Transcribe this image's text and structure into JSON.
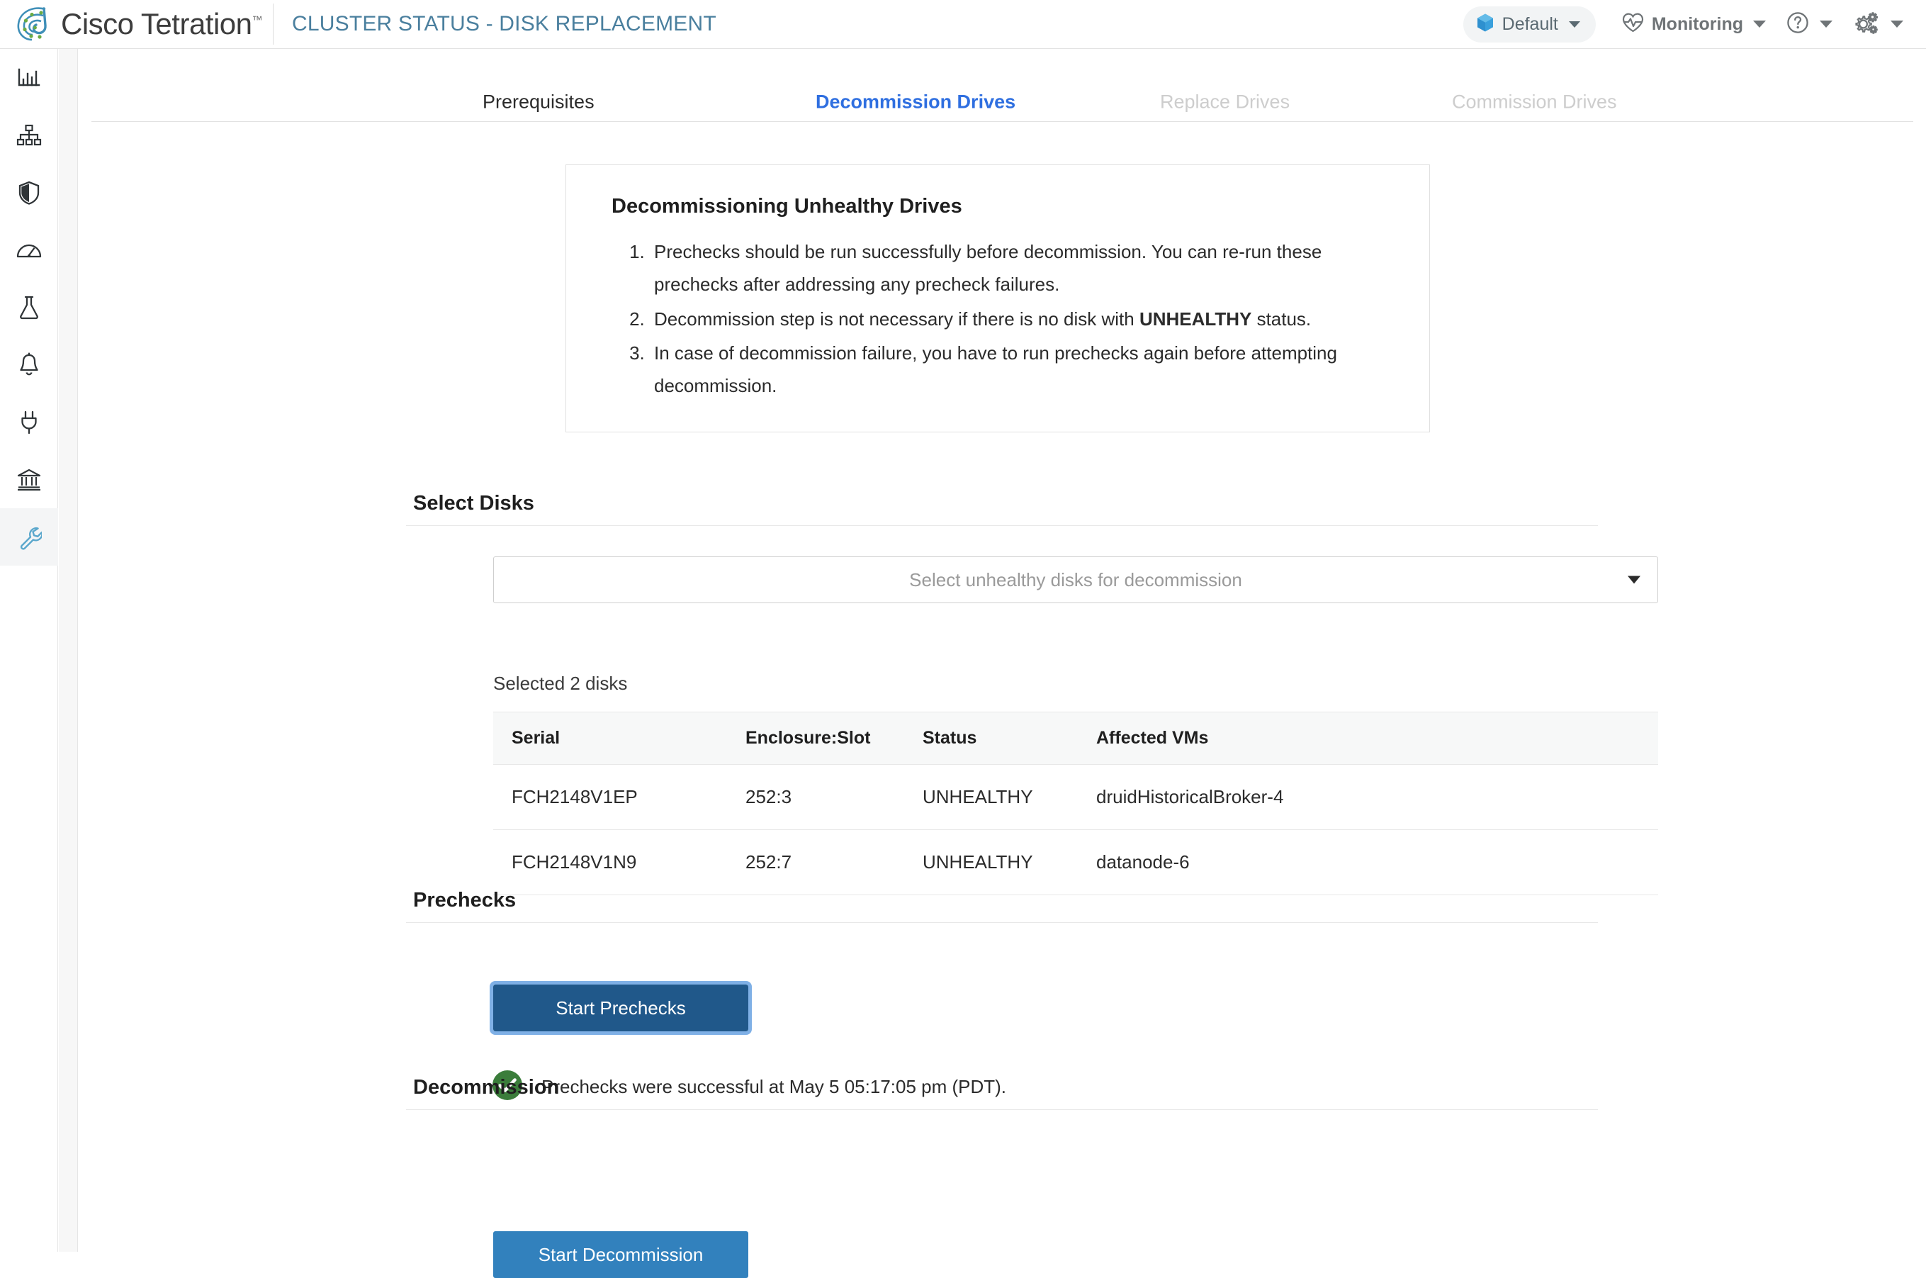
{
  "header": {
    "brand_name": "Cisco Tetration",
    "brand_tm": "™",
    "page_title": "CLUSTER STATUS - DISK REPLACEMENT",
    "scope_label": "Default",
    "monitoring_label": "Monitoring",
    "accent_color": "#4a7f9e",
    "brand_blue": "#3f8fb8",
    "brand_green": "#6aab44"
  },
  "sidebar": {
    "items": [
      {
        "icon": "bar-chart-icon",
        "active": false
      },
      {
        "icon": "sitemap-icon",
        "active": false
      },
      {
        "icon": "shield-icon",
        "active": false
      },
      {
        "icon": "gauge-icon",
        "active": false
      },
      {
        "icon": "flask-icon",
        "active": false
      },
      {
        "icon": "bell-icon",
        "active": false
      },
      {
        "icon": "plug-icon",
        "active": false
      },
      {
        "icon": "bank-icon",
        "active": false
      },
      {
        "icon": "wrench-icon",
        "active": true
      }
    ],
    "active_color": "#5aa7cc",
    "inactive_color": "#2f3437"
  },
  "tabs": [
    {
      "label": "Prerequisites",
      "state": "completed"
    },
    {
      "label": "Decommission Drives",
      "state": "active"
    },
    {
      "label": "Replace Drives",
      "state": "disabled"
    },
    {
      "label": "Commission Drives",
      "state": "disabled"
    }
  ],
  "info_card": {
    "title": "Decommissioning Unhealthy Drives",
    "items": [
      {
        "pre": "Prechecks should be run successfully before decommission. You can re-run these prechecks after addressing any precheck failures.",
        "bold": "",
        "post": ""
      },
      {
        "pre": "Decommission step is not necessary if there is no disk with ",
        "bold": "UNHEALTHY",
        "post": " status."
      },
      {
        "pre": "In case of decommission failure, you have to run prechecks again before attempting decommission.",
        "bold": "",
        "post": ""
      }
    ]
  },
  "select_disks": {
    "section_title": "Select Disks",
    "dropdown_placeholder": "Select unhealthy disks for decommission",
    "selected_count_text": "Selected 2 disks",
    "columns": [
      "Serial",
      "Enclosure:Slot",
      "Status",
      "Affected VMs"
    ],
    "rows": [
      {
        "serial": "FCH2148V1EP",
        "enclosure_slot": "252:3",
        "status": "UNHEALTHY",
        "affected_vms": "druidHistoricalBroker-4"
      },
      {
        "serial": "FCH2148V1N9",
        "enclosure_slot": "252:7",
        "status": "UNHEALTHY",
        "affected_vms": "datanode-6"
      }
    ]
  },
  "prechecks": {
    "section_title": "Prechecks",
    "button_label": "Start Prechecks",
    "status_message": "Prechecks were successful at May 5 05:17:05 pm (PDT).",
    "status_color": "#3b7d3b",
    "button_color": "#20588a",
    "focus_ring_color": "#7fb0e6"
  },
  "decommission": {
    "section_title": "Decommission",
    "button_label": "Start Decommission",
    "button_color": "#3281bd"
  }
}
